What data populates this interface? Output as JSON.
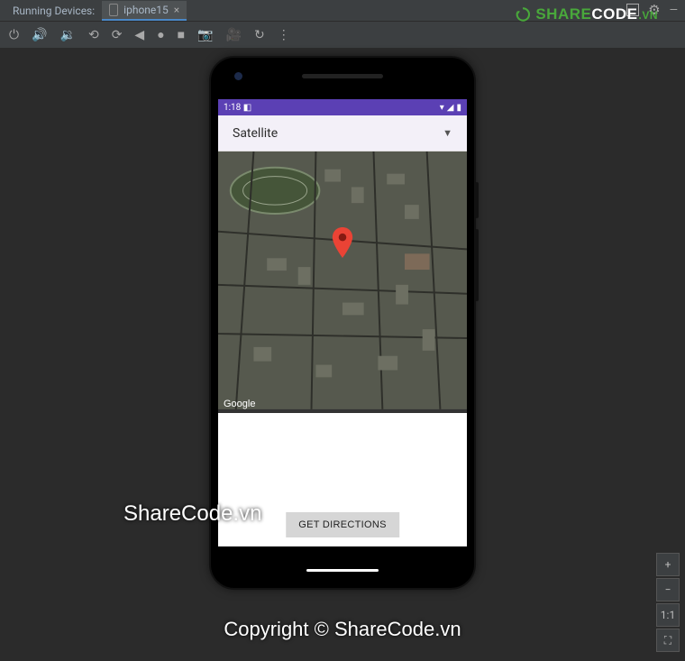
{
  "ide": {
    "tab_label": "Running Devices:",
    "active_tab": "iphone15",
    "right_controls": {
      "zoom_in": "+",
      "zoom_out": "−",
      "one_to_one": "1:1",
      "fullscreen": "⛶"
    }
  },
  "app": {
    "status_time": "1:18",
    "status_debug": "◧",
    "dropdown_label": "Satellite",
    "map_attribution": "Google",
    "get_directions_label": "GET DIRECTIONS"
  },
  "watermarks": {
    "sharecode": "ShareCode.vn",
    "copyright": "Copyright © ShareCode.vn",
    "logo_share": "SHARE",
    "logo_code": "CODE",
    "logo_vn": ".VN"
  }
}
